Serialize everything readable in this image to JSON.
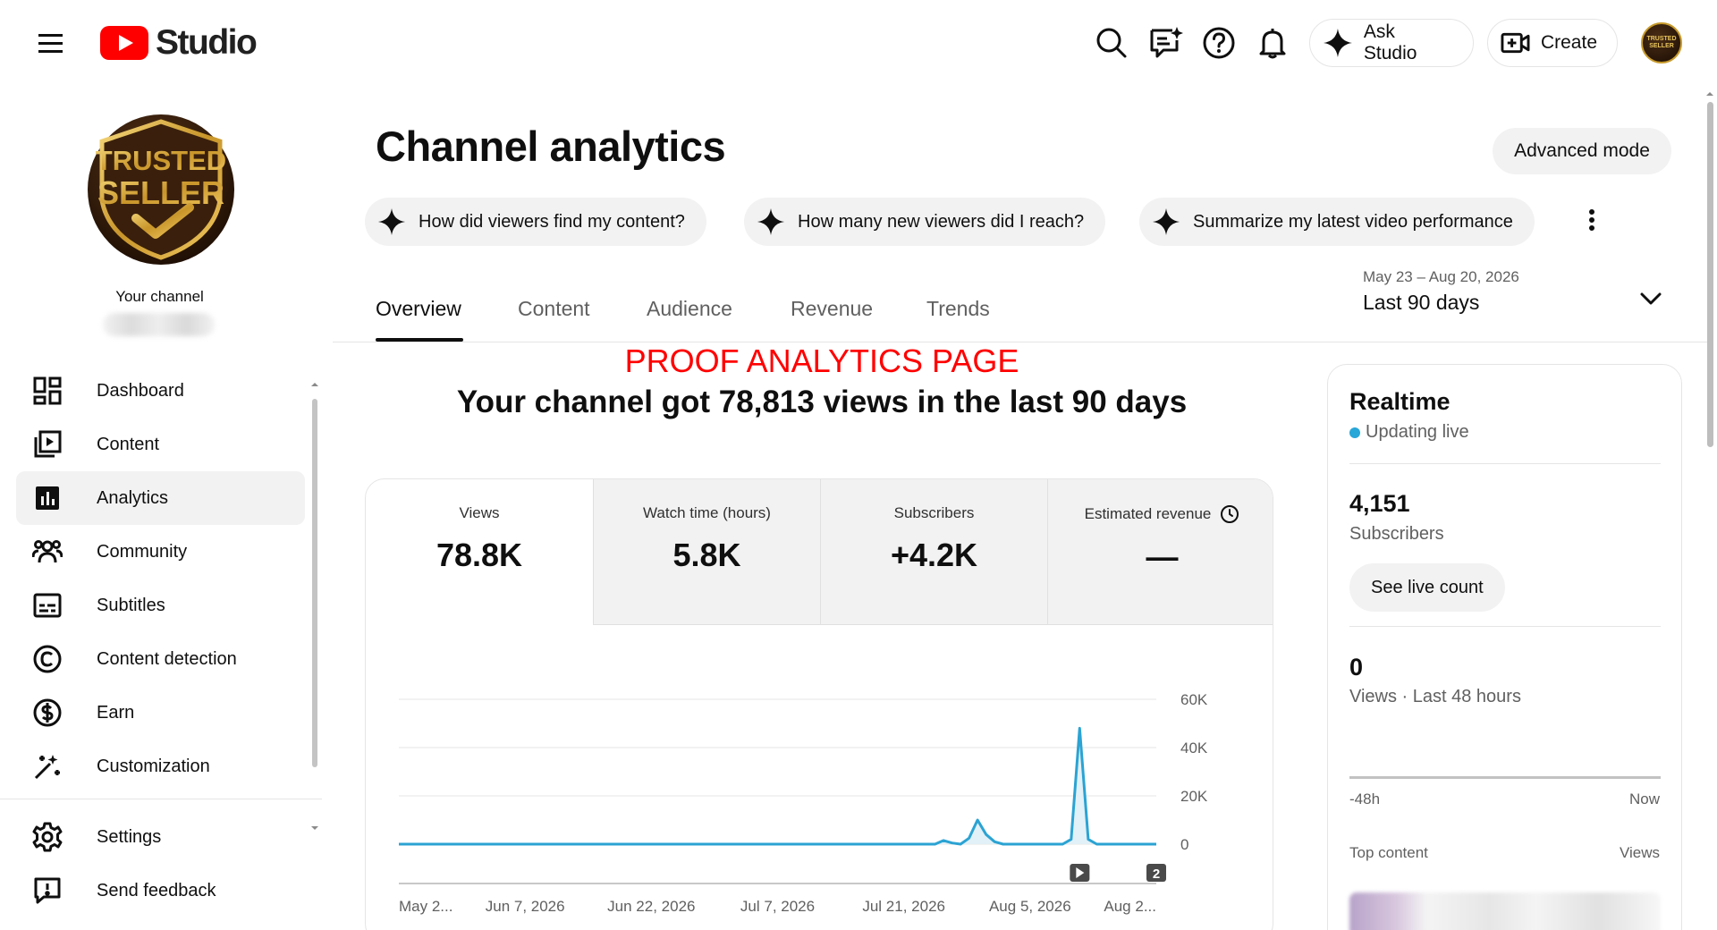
{
  "header": {
    "logo_text": "Studio",
    "ask_studio_label": "Ask Studio",
    "create_label": "Create",
    "avatar_text_line1": "TRUSTED",
    "avatar_text_line2": "SELLER"
  },
  "sidebar": {
    "channel_badge_line1": "TRUSTED",
    "channel_badge_line2": "SELLER",
    "your_channel_label": "Your channel",
    "items": [
      {
        "label": "Dashboard",
        "icon": "dashboard-icon"
      },
      {
        "label": "Content",
        "icon": "content-icon"
      },
      {
        "label": "Analytics",
        "icon": "analytics-icon",
        "active": true
      },
      {
        "label": "Community",
        "icon": "community-icon"
      },
      {
        "label": "Subtitles",
        "icon": "subtitles-icon"
      },
      {
        "label": "Content detection",
        "icon": "copyright-icon"
      },
      {
        "label": "Earn",
        "icon": "dollar-icon"
      },
      {
        "label": "Customization",
        "icon": "magic-wand-icon"
      }
    ],
    "bottom_items": [
      {
        "label": "Settings",
        "icon": "gear-icon"
      },
      {
        "label": "Send feedback",
        "icon": "feedback-icon"
      }
    ]
  },
  "main": {
    "title": "Channel analytics",
    "advanced_mode_label": "Advanced mode",
    "chips": [
      "How did viewers find my content?",
      "How many new viewers did I reach?",
      "Summarize my latest video performance"
    ],
    "tabs": [
      "Overview",
      "Content",
      "Audience",
      "Revenue",
      "Trends"
    ],
    "active_tab": "Overview",
    "date_range_sub": "May 23 – Aug 20, 2026",
    "date_range_main": "Last 90 days",
    "proof_text": "PROOF ANALYTICS PAGE",
    "headline": "Your channel got 78,813 views in the last 90 days",
    "metrics": [
      {
        "label": "Views",
        "value": "78.8K"
      },
      {
        "label": "Watch time (hours)",
        "value": "5.8K"
      },
      {
        "label": "Subscribers",
        "value": "+4.2K"
      },
      {
        "label": "Estimated revenue",
        "value": "—"
      }
    ]
  },
  "chart_data": {
    "type": "line",
    "series": [
      {
        "values": [
          0,
          0,
          0,
          0,
          0,
          0,
          0,
          0,
          0,
          0,
          0,
          0,
          0,
          0,
          0,
          0,
          0,
          0,
          0,
          0,
          0,
          0,
          0,
          0,
          0,
          0,
          0,
          0,
          0,
          0,
          0,
          0,
          0,
          0,
          0,
          0,
          0,
          0,
          0,
          0,
          0,
          0,
          0,
          0,
          0,
          0,
          0,
          0,
          0,
          0,
          0,
          0,
          0,
          0,
          0,
          0,
          0,
          0,
          0,
          0,
          0,
          0,
          0,
          0,
          1500,
          500,
          0,
          2500,
          10000,
          4000,
          1000,
          0,
          0,
          0,
          0,
          0,
          0,
          0,
          0,
          2000,
          48000,
          2000,
          0,
          0,
          0,
          0,
          0,
          0,
          0,
          0
        ]
      }
    ],
    "x_tick_labels": [
      "May 2...",
      "Jun 7, 2026",
      "Jun 22, 2026",
      "Jul 7, 2026",
      "Jul 21, 2026",
      "Aug 5, 2026",
      "Aug 2..."
    ],
    "y_tick_labels": [
      "60K",
      "40K",
      "20K",
      "0"
    ],
    "ylim": [
      0,
      60000
    ],
    "grid": true,
    "markers": [
      {
        "kind": "play",
        "label": ""
      },
      {
        "kind": "count",
        "label": "2"
      }
    ],
    "color": "#2ba3d3"
  },
  "realtime": {
    "title": "Realtime",
    "live_label": "Updating live",
    "subscribers_value": "4,151",
    "subscribers_label": "Subscribers",
    "see_live_label": "See live count",
    "views_value": "0",
    "views_label": "Views · Last 48 hours",
    "axis_left": "-48h",
    "axis_right": "Now",
    "top_content_label": "Top content",
    "top_content_right": "Views"
  },
  "colors": {
    "brand_red": "#ff0000",
    "chart_line": "#2ba3d3",
    "live_dot": "#27a6d8"
  }
}
